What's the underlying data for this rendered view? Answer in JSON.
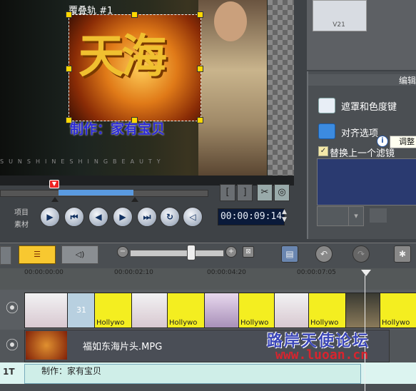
{
  "preview": {
    "overlay_track_title": "覆叠轨 #1",
    "logo_text": "天海",
    "caption": "制作：家有宝贝",
    "bottom_text": "SUNSHINESHINGBEAUTY"
  },
  "right_panel": {
    "thumb_label": "V21",
    "edit_header": "编辑",
    "mask_label": "遮罩和色度键",
    "align_label": "对齐选项",
    "replace_filter_label": "替换上一个滤镜",
    "replace_filter_checked": true,
    "tooltip": "调整"
  },
  "transport": {
    "project_label": "项目",
    "clip_label": "素材",
    "timecode": "00:00:09:14",
    "buttons": [
      "play",
      "home",
      "prev",
      "next",
      "end",
      "repeat",
      "volume"
    ]
  },
  "ruler": {
    "ticks": [
      "00:00:00:00",
      "00:00:02:10",
      "00:00:04:20",
      "00:00:07:05"
    ]
  },
  "tracks": {
    "video_clips": [
      "Hollywo",
      "Hollywo",
      "Hollywo",
      "Hollywo",
      "Hollywo"
    ],
    "video_number": "31",
    "overlay_clip_name": "福如东海片头.MPG",
    "title_clip_text": "制作：家有宝贝"
  },
  "watermark": {
    "text": "路岸天使论坛",
    "url": "www.luoan.cn"
  },
  "colors": {
    "storyboard_active": "#f8c830",
    "timecode_bg": "#0a1a3a",
    "handle": "#ffd800"
  }
}
